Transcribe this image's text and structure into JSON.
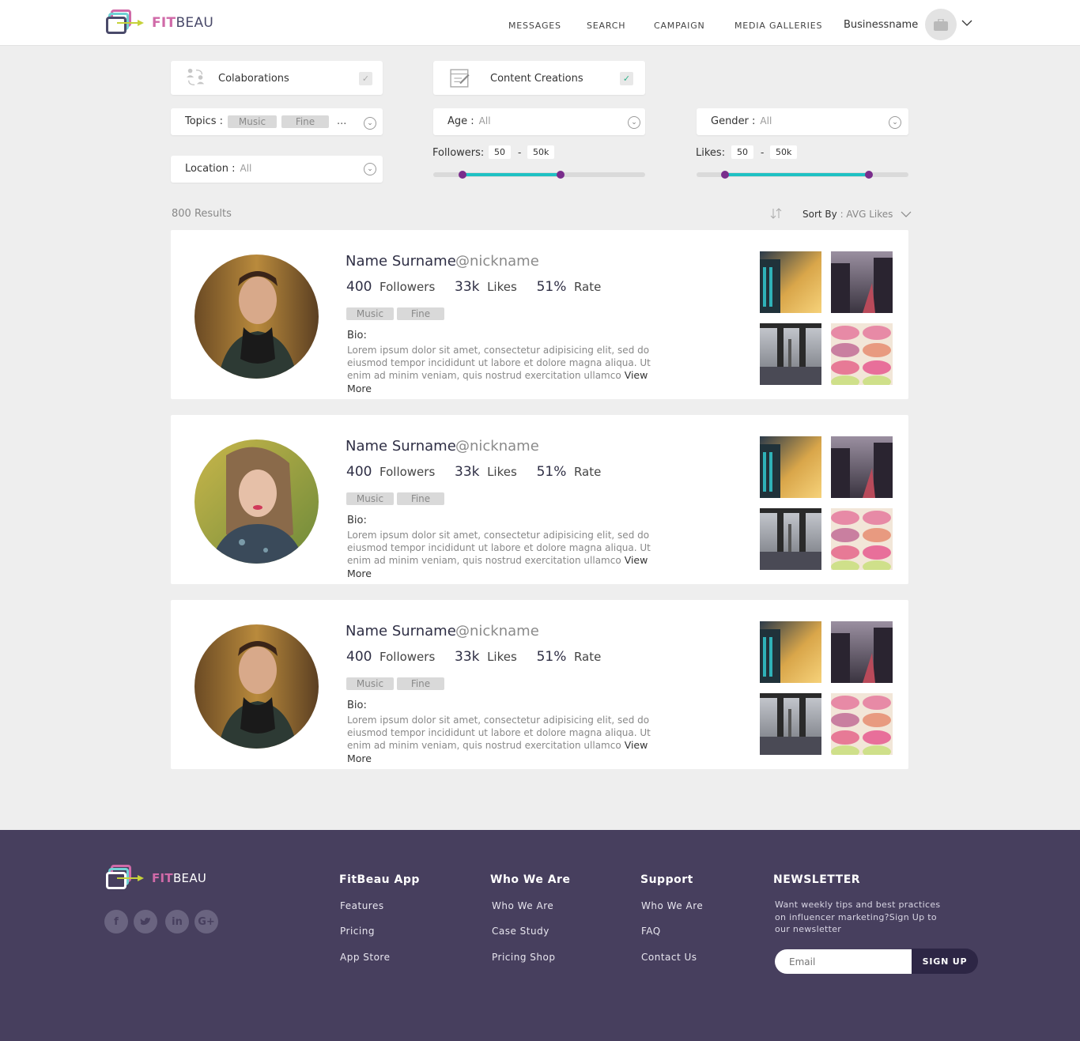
{
  "header": {
    "logo_fit": "FIT",
    "logo_beau": "BEAU",
    "nav": [
      "MESSAGES",
      "SEARCH",
      "CAMPAIGN",
      "MEDIA GALLERIES"
    ],
    "business_name": "Businessname",
    "avatar_icon": "briefcase-icon",
    "dropdown_icon": "chevron-down-icon"
  },
  "filters": {
    "collaborations": {
      "label": "Colaborations",
      "checked": true
    },
    "content_creations": {
      "label": "Content Creations",
      "checked": true
    },
    "topics": {
      "label": "Topics :",
      "tags": [
        "Music",
        "Fine"
      ],
      "more": "..."
    },
    "location": {
      "label": "Location :",
      "value": "All"
    },
    "age": {
      "label": "Age :",
      "value": "All"
    },
    "gender": {
      "label": "Gender :",
      "value": "All"
    },
    "followers": {
      "label": "Followers:",
      "min": "50",
      "dash": "-",
      "max": "50k"
    },
    "likes": {
      "label": "Likes:",
      "min": "50",
      "dash": "-",
      "max": "50k"
    }
  },
  "results": {
    "count_text": "800 Results",
    "sort_label": "Sort By",
    "sort_value": ": AVG Likes"
  },
  "cards": [
    {
      "name": "Name Surname",
      "nickname": "@nickname",
      "followers_value": "400",
      "followers_label": "Followers",
      "likes_value": "33k",
      "likes_label": "Likes",
      "rate_value": "51%",
      "rate_label": "Rate",
      "tags": [
        "Music",
        "Fine"
      ],
      "bio_label": "Bio:",
      "bio": "Lorem ipsum dolor sit amet, consectetur adipisicing elit, sed do eiusmod tempor incididunt ut labore et dolore magna aliqua. Ut enim ad minim veniam, quis nostrud exercitation ullamco",
      "view_more": "View More"
    },
    {
      "name": "Name Surname",
      "nickname": "@nickname",
      "followers_value": "400",
      "followers_label": "Followers",
      "likes_value": "33k",
      "likes_label": "Likes",
      "rate_value": "51%",
      "rate_label": "Rate",
      "tags": [
        "Music",
        "Fine"
      ],
      "bio_label": "Bio:",
      "bio": "Lorem ipsum dolor sit amet, consectetur adipisicing elit, sed do eiusmod tempor incididunt ut labore et dolore magna aliqua. Ut enim ad minim veniam, quis nostrud exercitation ullamco",
      "view_more": "View More"
    },
    {
      "name": "Name Surname",
      "nickname": "@nickname",
      "followers_value": "400",
      "followers_label": "Followers",
      "likes_value": "33k",
      "likes_label": "Likes",
      "rate_value": "51%",
      "rate_label": "Rate",
      "tags": [
        "Music",
        "Fine"
      ],
      "bio_label": "Bio:",
      "bio": "Lorem ipsum dolor sit amet, consectetur adipisicing elit, sed do eiusmod tempor incididunt ut labore et dolore magna aliqua. Ut enim ad minim veniam, quis nostrud exercitation ullamco",
      "view_more": "View More"
    }
  ],
  "footer": {
    "logo_fit": "FIT",
    "logo_beau": "BEAU",
    "social_icons": [
      "facebook-icon",
      "twitter-icon",
      "linkedin-icon",
      "google-plus-icon"
    ],
    "columns": [
      {
        "title": "FitBeau App",
        "links": [
          "Features",
          "Pricing",
          "App Store"
        ]
      },
      {
        "title": "Who We Are",
        "links": [
          "Who We Are",
          "Case Study",
          "Pricing Shop"
        ]
      },
      {
        "title": "Support",
        "links": [
          "Who We Are",
          "FAQ",
          "Contact Us"
        ]
      }
    ],
    "newsletter": {
      "title": "NEWSLETTER",
      "text": "Want weekly tips and best practices on influencer marketing?Sign Up to our newsletter",
      "placeholder": "Email",
      "button": "SIGN UP"
    }
  },
  "colors": {
    "accent_teal": "#1fc1c3",
    "slider_knob": "#7a2d8c",
    "brand_pink": "#d06aa8",
    "footer_bg": "#473f5e",
    "check_green": "#2fb28a"
  }
}
